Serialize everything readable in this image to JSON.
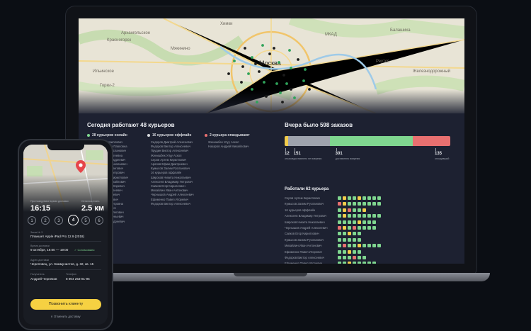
{
  "map": {
    "city": "Москва",
    "labels": [
      "Красногорск",
      "Архангельское",
      "Мякинино",
      "Химки",
      "Балашиха",
      "Реутов",
      "Железнодорожный",
      "Ильинское",
      "Горки-2",
      "МКАД"
    ]
  },
  "couriers": {
    "title": "Сегодня работают 48 курьеров",
    "online_legend": "28 курьеров онлайн",
    "offline_legend": "16 курьеров оффлайн",
    "late_legend": "2 курьера опаздывают",
    "online": [
      "Серов Артем Кириллович",
      "Жукова Екатерина Павловна",
      "Кумысов Залим Русланович",
      "Исаева Мария Сергеевна",
      "Леонов Виталий Андреевич",
      "Широков Никита Николаевич",
      "Гусейнов Ахмед Олегович",
      "Андреев Михаил Петрович",
      "Кравченко Тимур Кириллович",
      "Захаров Денис Михайлович",
      "Ефименко Павел Игоревич",
      "Морозов Глеб Андреевич",
      "Рябов Игорь Сергеевич",
      "Фомин Олег Павлович",
      "Кузнецова Анна Петровна",
      "Смирнов Егор Ильич",
      "Дмитриев Антон Олегович",
      "Соболев Иван Евгеньевич",
      "Семенов Павел Андреевич"
    ],
    "offline": [
      "Сидоров Дмитрий Алексеевич",
      "Федоров Виктор Алексеевич",
      "Прудин Виктор Алексеевич",
      "Женишбек Улуу Аскол",
      "Серов Артем Кириллович",
      "Арапов Ефим Дмитриевич",
      "Кумысов Залим Русланович",
      "16 курьеров оффлайн",
      "Широков Никита Николаевич",
      "Алексеев Владимир Петрович",
      "Савков Егор Кириллович",
      "Михайлин Иван Антонович",
      "Чернышов Андрей Алексеевич",
      "Ефименко Павел Игоревич",
      "Федоров Виктор Алексеевич"
    ],
    "late": [
      "Женишбек Улуу Аскол",
      "Назаров Андрей Михайлович"
    ]
  },
  "orders": {
    "title": "Вчера было 598 заказов",
    "segments": [
      {
        "value": 12,
        "label": "отказов",
        "color": "#f2cc4b"
      },
      {
        "value": 151,
        "label": "доставлено не вовремя",
        "color": "#9ea3ad"
      },
      {
        "value": 301,
        "label": "доставлено вовремя",
        "color": "#7fd68f"
      },
      {
        "value": 135,
        "label": "опоздавший",
        "color": "#e87070"
      }
    ],
    "workers_title": "Работали 62 курьера",
    "workers": [
      {
        "name": "Серов Артем Кириллович",
        "cells": [
          "g",
          "y",
          "g",
          "g",
          "y",
          "g",
          "g",
          "g",
          "g"
        ]
      },
      {
        "name": "Кумысов Залим Русланович",
        "cells": [
          "r",
          "y",
          "g",
          "g",
          "g",
          "g",
          "g",
          "g",
          "g"
        ]
      },
      {
        "name": "16 курьеров оффлайн",
        "cells": [
          "g",
          "y",
          "r",
          "g",
          "g",
          "y"
        ]
      },
      {
        "name": "Алексеев Владимир Петрович",
        "cells": [
          "g",
          "y",
          "g",
          "g",
          "g",
          "g",
          "g",
          "g",
          "g"
        ]
      },
      {
        "name": "Широков Никита Николаевич",
        "cells": [
          "g",
          "g",
          "g",
          "g",
          "y",
          "g",
          "g",
          "g"
        ]
      },
      {
        "name": "Чернышов Андрей Алексеевич",
        "cells": [
          "r",
          "y",
          "g",
          "r",
          "g",
          "g",
          "g",
          "g"
        ]
      },
      {
        "name": "Савков Егор Кириллович",
        "cells": [
          "g",
          "g",
          "y",
          "g",
          "g"
        ]
      },
      {
        "name": "Кумысов Залим Русланович",
        "cells": [
          "g",
          "g",
          "g",
          "g",
          "g"
        ]
      },
      {
        "name": "Михайлин Иван Антонович",
        "cells": [
          "g",
          "r",
          "g",
          "g",
          "y",
          "g",
          "g",
          "g",
          "g"
        ]
      },
      {
        "name": "Ефименко Павел Игоревич",
        "cells": [
          "g",
          "g",
          "y",
          "g",
          "g"
        ]
      },
      {
        "name": "Федоров Виктор Алексеевич",
        "cells": [
          "g",
          "g",
          "g",
          "r",
          "g",
          "g"
        ]
      },
      {
        "name": "Ефименко Павел Игоревич",
        "cells": [
          "g",
          "g",
          "y",
          "g",
          "g",
          "g",
          "g",
          "g"
        ]
      }
    ]
  },
  "phone": {
    "arrival_label": "Прогнозируемое время доставки",
    "arrival_time": "16:15",
    "distance_label": "Осталось ехать",
    "distance": "2.5 км",
    "steps": [
      "1",
      "2",
      "3",
      "4",
      "5",
      "6"
    ],
    "active_step": "4",
    "order_label": "Заказ № 3",
    "order_value": "Планшет Apple iPad Pro 12.9 (2018)",
    "time_label": "Время доставки",
    "time_value": "9 октября, 16:00 — 19:00",
    "agreed": "✓ Согласовано",
    "address_label": "Адрес доставки",
    "address_value": "Череповец, ул. Коммунистов, д. 32, кв. 15",
    "client_label": "Получатель",
    "client_value": "Андрей Черняков",
    "phone_label": "Телефон",
    "phone_value": "8 904 253-81-95",
    "call_button": "Позвонить клиенту",
    "cancel": "✕  Отменить доставку"
  }
}
